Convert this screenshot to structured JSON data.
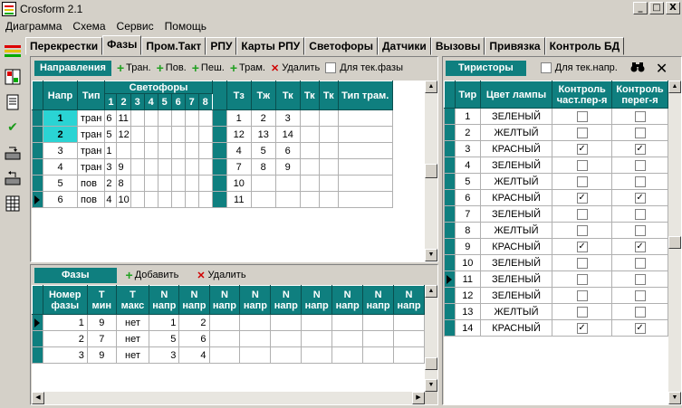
{
  "window": {
    "title": "Crosform 2.1",
    "min": "_",
    "max": "□",
    "close": "X"
  },
  "menu": [
    "Диаграмма",
    "Схема",
    "Сервис",
    "Помощь"
  ],
  "tabs": [
    "Перекрестки",
    "Фазы",
    "Пром.Такт",
    "РПУ",
    "Карты РПУ",
    "Светофоры",
    "Датчики",
    "Вызовы",
    "Привязка",
    "Контроль БД"
  ],
  "active_tab": "Фазы",
  "directions": {
    "title": "Направления",
    "toolbar": {
      "tran": "Тран.",
      "pov": "Пов.",
      "pesh": "Пеш.",
      "tram": "Трам.",
      "delete": "Удалить",
      "for_current": "Для тек.фазы"
    },
    "headers": {
      "napr": "Напр",
      "tip": "Тип",
      "svetofory": "Светофоры",
      "sv_cols": [
        "1",
        "2",
        "3",
        "4",
        "5",
        "6",
        "7",
        "8"
      ],
      "tz": "Тз",
      "tzh": "Тж",
      "tk": "Тк",
      "tk2": "Тк",
      "tk3": "Тк",
      "tip_tram": "Тип трам."
    },
    "rows": [
      {
        "napr": "1",
        "tip": "тран",
        "sv": [
          "6",
          "11",
          "",
          "",
          "",
          "",
          "",
          ""
        ],
        "tz": "1",
        "tzh": "2",
        "tk": "3"
      },
      {
        "napr": "2",
        "tip": "тран",
        "sv": [
          "5",
          "12",
          "",
          "",
          "",
          "",
          "",
          ""
        ],
        "tz": "12",
        "tzh": "13",
        "tk": "14"
      },
      {
        "napr": "3",
        "tip": "тран",
        "sv": [
          "1",
          "",
          "",
          "",
          "",
          "",
          "",
          ""
        ],
        "tz": "4",
        "tzh": "5",
        "tk": "6"
      },
      {
        "napr": "4",
        "tip": "тран",
        "sv": [
          "3",
          "9",
          "",
          "",
          "",
          "",
          "",
          ""
        ],
        "tz": "7",
        "tzh": "8",
        "tk": "9"
      },
      {
        "napr": "5",
        "tip": "пов",
        "sv": [
          "2",
          "8",
          "",
          "",
          "",
          "",
          "",
          ""
        ],
        "tz": "10",
        "tzh": "",
        "tk": ""
      },
      {
        "napr": "6",
        "tip": "пов",
        "sv": [
          "4",
          "10",
          "",
          "",
          "",
          "",
          "",
          ""
        ],
        "tz": "11",
        "tzh": "",
        "tk": ""
      }
    ]
  },
  "phases": {
    "title": "Фазы",
    "toolbar": {
      "add": "Добавить",
      "delete": "Удалить"
    },
    "headers": [
      "Номер фазы",
      "Т мин",
      "Т макс",
      "N напр",
      "N напр",
      "N напр",
      "N напр",
      "N напр",
      "N напр",
      "N напр",
      "N напр",
      "N напр"
    ],
    "rows": [
      {
        "num": "1",
        "tmin": "9",
        "tmax": "нет",
        "n1": "1",
        "n2": "2"
      },
      {
        "num": "2",
        "tmin": "7",
        "tmax": "нет",
        "n1": "5",
        "n2": "6"
      },
      {
        "num": "3",
        "tmin": "9",
        "tmax": "нет",
        "n1": "3",
        "n2": "4"
      }
    ]
  },
  "thyristors": {
    "title": "Тиристоры",
    "for_current": "Для тек.напр.",
    "headers": {
      "tir": "Тир",
      "color": "Цвет лампы",
      "ctrl1": "Контроль част.пер-я",
      "ctrl2": "Контроль перег-я"
    },
    "rows": [
      {
        "tir": "1",
        "color": "ЗЕЛЕНЫЙ",
        "c1": false,
        "c2": false
      },
      {
        "tir": "2",
        "color": "ЖЕЛТЫЙ",
        "c1": false,
        "c2": false
      },
      {
        "tir": "3",
        "color": "КРАСНЫЙ",
        "c1": true,
        "c2": true
      },
      {
        "tir": "4",
        "color": "ЗЕЛЕНЫЙ",
        "c1": false,
        "c2": false
      },
      {
        "tir": "5",
        "color": "ЖЕЛТЫЙ",
        "c1": false,
        "c2": false
      },
      {
        "tir": "6",
        "color": "КРАСНЫЙ",
        "c1": true,
        "c2": true
      },
      {
        "tir": "7",
        "color": "ЗЕЛЕНЫЙ",
        "c1": false,
        "c2": false
      },
      {
        "tir": "8",
        "color": "ЖЕЛТЫЙ",
        "c1": false,
        "c2": false
      },
      {
        "tir": "9",
        "color": "КРАСНЫЙ",
        "c1": true,
        "c2": true
      },
      {
        "tir": "10",
        "color": "ЗЕЛЕНЫЙ",
        "c1": false,
        "c2": false
      },
      {
        "tir": "11",
        "color": "ЗЕЛЕНЫЙ",
        "c1": false,
        "c2": false
      },
      {
        "tir": "12",
        "color": "ЗЕЛЕНЫЙ",
        "c1": false,
        "c2": false
      },
      {
        "tir": "13",
        "color": "ЖЕЛТЫЙ",
        "c1": false,
        "c2": false
      },
      {
        "tir": "14",
        "color": "КРАСНЫЙ",
        "c1": true,
        "c2": true
      }
    ]
  },
  "colors": {
    "header": "#0f7f7f",
    "selected": "#2ad4d4",
    "surface": "#d4d0c8"
  },
  "icons": [
    "diagram-icon",
    "grid-icon",
    "document-icon",
    "checkmark-icon",
    "export-icon",
    "import-icon",
    "table-icon",
    "binoculars-icon",
    "close-icon"
  ]
}
